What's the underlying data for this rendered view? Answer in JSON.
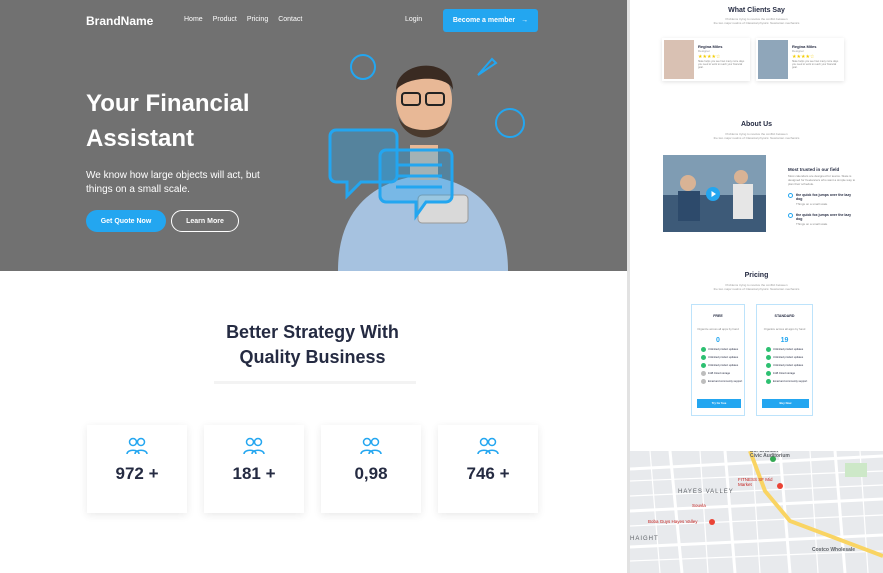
{
  "header": {
    "brand": "BrandName",
    "nav": [
      "Home",
      "Product",
      "Pricing",
      "Contact"
    ],
    "login": "Login",
    "cta": "Become a member"
  },
  "hero": {
    "title": "Your Financial Assistant",
    "subtitle": "We know how large objects will act, but things on a small scale.",
    "primary_btn": "Get Quote Now",
    "secondary_btn": "Learn More"
  },
  "strategy": {
    "title_line1": "Better Strategy With",
    "title_line2": "Quality Business",
    "stats": [
      "972 +",
      "181 +",
      "0,98",
      "746 +"
    ]
  },
  "testimonials": {
    "title": "What Clients Say",
    "subtitle_line1": "Problems trying to resolve the conflict between",
    "subtitle_line2": "the two major realms of Classical physics: Newtonian mechanics",
    "cards": [
      {
        "name": "Regina Miles",
        "role": "Designer",
        "stars": "★★★★☆",
        "text": "Slate helps you see how many more days you need to work to reach your financial goal."
      },
      {
        "name": "Regina Miles",
        "role": "Designer",
        "stars": "★★★★☆",
        "text": "Slate helps you see how many more days you need to work to reach your financial goal."
      }
    ]
  },
  "about": {
    "title": "About Us",
    "subtitle_line1": "Problems trying to resolve the conflict between",
    "subtitle_line2": "the two major realms of Classical physics: Newtonian mechanics",
    "trust_title": "Most trusted in our field",
    "trust_text": "Most calendars are designed for teams. Slate is designed for freelancers who want a simple way to plan their schedule.",
    "items": [
      {
        "title": "the quick fox jumps over the lazy dog",
        "text": "Things on a small scale"
      },
      {
        "title": "the quick fox jumps over the lazy dog",
        "text": "Things on a small scale"
      }
    ]
  },
  "pricing": {
    "title": "Pricing",
    "subtitle_line1": "Problems trying to resolve the conflict between",
    "subtitle_line2": "the two major realms of Classical physics: Newtonian mechanics",
    "plans": [
      {
        "name": "FREE",
        "desc": "Organize across all apps by hand",
        "price": "0",
        "button": "Try for free"
      },
      {
        "name": "STANDARD",
        "desc": "Organize across all apps by hand",
        "price": "19",
        "button": "Buy Now"
      }
    ],
    "features": [
      "Unlimited product updates",
      "Unlimited product updates",
      "Unlimited product updates",
      "1GB Cloud storage",
      "Email and community support"
    ]
  },
  "map": {
    "labels": [
      "Bill Graham Civic Auditorium",
      "FITNESS SF Mid Market",
      "HAYES VALLEY",
      "Souvla",
      "Boba Guys Hayes Valley",
      "Costco Wholesale",
      "HAIGHT"
    ]
  },
  "colors": {
    "accent": "#23a6f0",
    "hero_bg": "#717171",
    "heading": "#252b42",
    "success": "#2dc071"
  }
}
